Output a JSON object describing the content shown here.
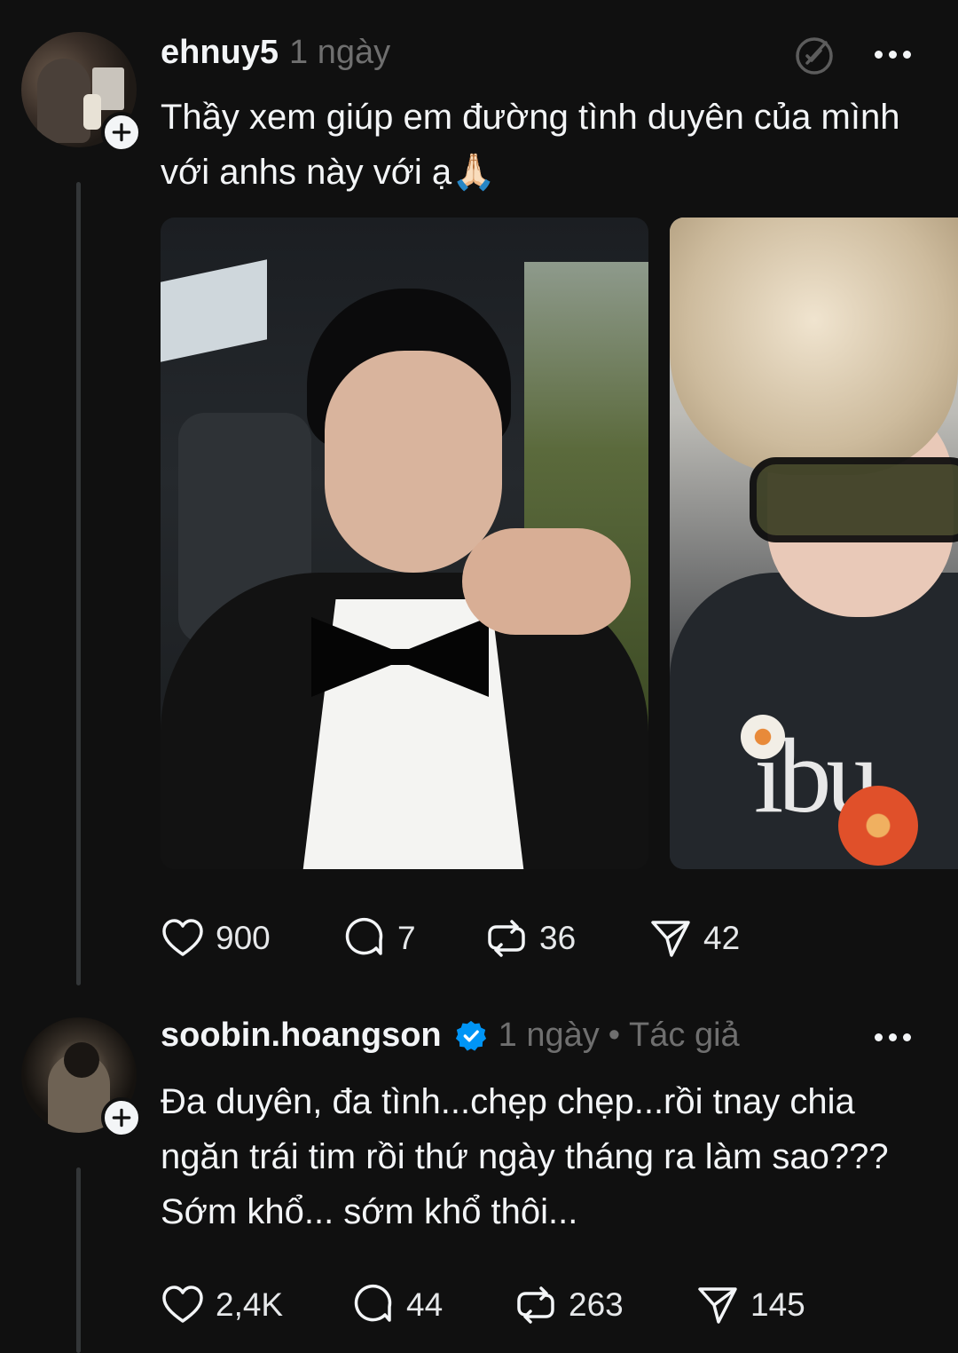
{
  "post1": {
    "username": "ehnuy5",
    "time": "1 ngày",
    "text": "Thầy xem giúp em đường tình duyên của mình với anhs này với ạ🙏🏻",
    "actions": {
      "likes": "900",
      "comments": "7",
      "reposts": "36",
      "shares": "42"
    }
  },
  "post2": {
    "username": "soobin.hoangson",
    "verified": true,
    "time": "1 ngày",
    "separator": "•",
    "author_label": "Tác giả",
    "text": "Đa duyên, đa tình...chẹp chẹp...rồi tnay chia ngăn trái tim rồi thứ ngày tháng ra làm sao??? Sớm khổ... sớm khổ thôi...",
    "actions": {
      "likes": "2,4K",
      "comments": "44",
      "reposts": "263",
      "shares": "145"
    }
  },
  "icons": {
    "follow": "plus-icon",
    "more": "more-icon",
    "mute": "mute-icon",
    "like": "heart-icon",
    "comment": "comment-icon",
    "repost": "repost-icon",
    "share": "share-icon",
    "verified": "verified-badge-icon"
  },
  "colors": {
    "background": "#101010",
    "text": "#f3f5f7",
    "muted": "#6f6f6f",
    "verified": "#0095f6"
  }
}
